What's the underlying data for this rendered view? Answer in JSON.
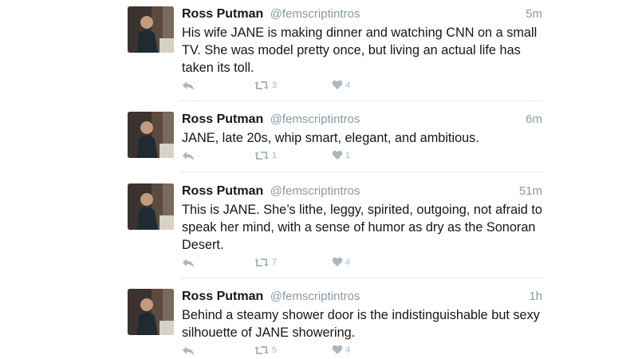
{
  "tweets": [
    {
      "name": "Ross Putman",
      "handle": "@femscriptintros",
      "time": "5m",
      "text": "His wife JANE is making dinner and watching CNN on a small TV. She was model pretty once, but living an actual life has taken its toll.",
      "retweets": "3",
      "likes": "4"
    },
    {
      "name": "Ross Putman",
      "handle": "@femscriptintros",
      "time": "6m",
      "text": "JANE, late 20s, whip smart, elegant, and ambitious.",
      "retweets": "1",
      "likes": "1"
    },
    {
      "name": "Ross Putman",
      "handle": "@femscriptintros",
      "time": "51m",
      "text": "This is JANE. She’s lithe, leggy, spirited, outgoing, not afraid to speak her mind, with a sense of humor as dry as the Sonoran Desert.",
      "retweets": "7",
      "likes": "4"
    },
    {
      "name": "Ross Putman",
      "handle": "@femscriptintros",
      "time": "1h",
      "text": "Behind a steamy shower door is the indistinguishable but sexy silhouette of JANE showering.",
      "retweets": "5",
      "likes": "4"
    }
  ],
  "icons": {
    "reply": "reply-icon",
    "retweet": "retweet-icon",
    "like": "heart-icon"
  },
  "colors": {
    "text": "#14171a",
    "muted": "#8899a6",
    "icon": "#aab8c2",
    "divider": "#e6ecf0"
  }
}
